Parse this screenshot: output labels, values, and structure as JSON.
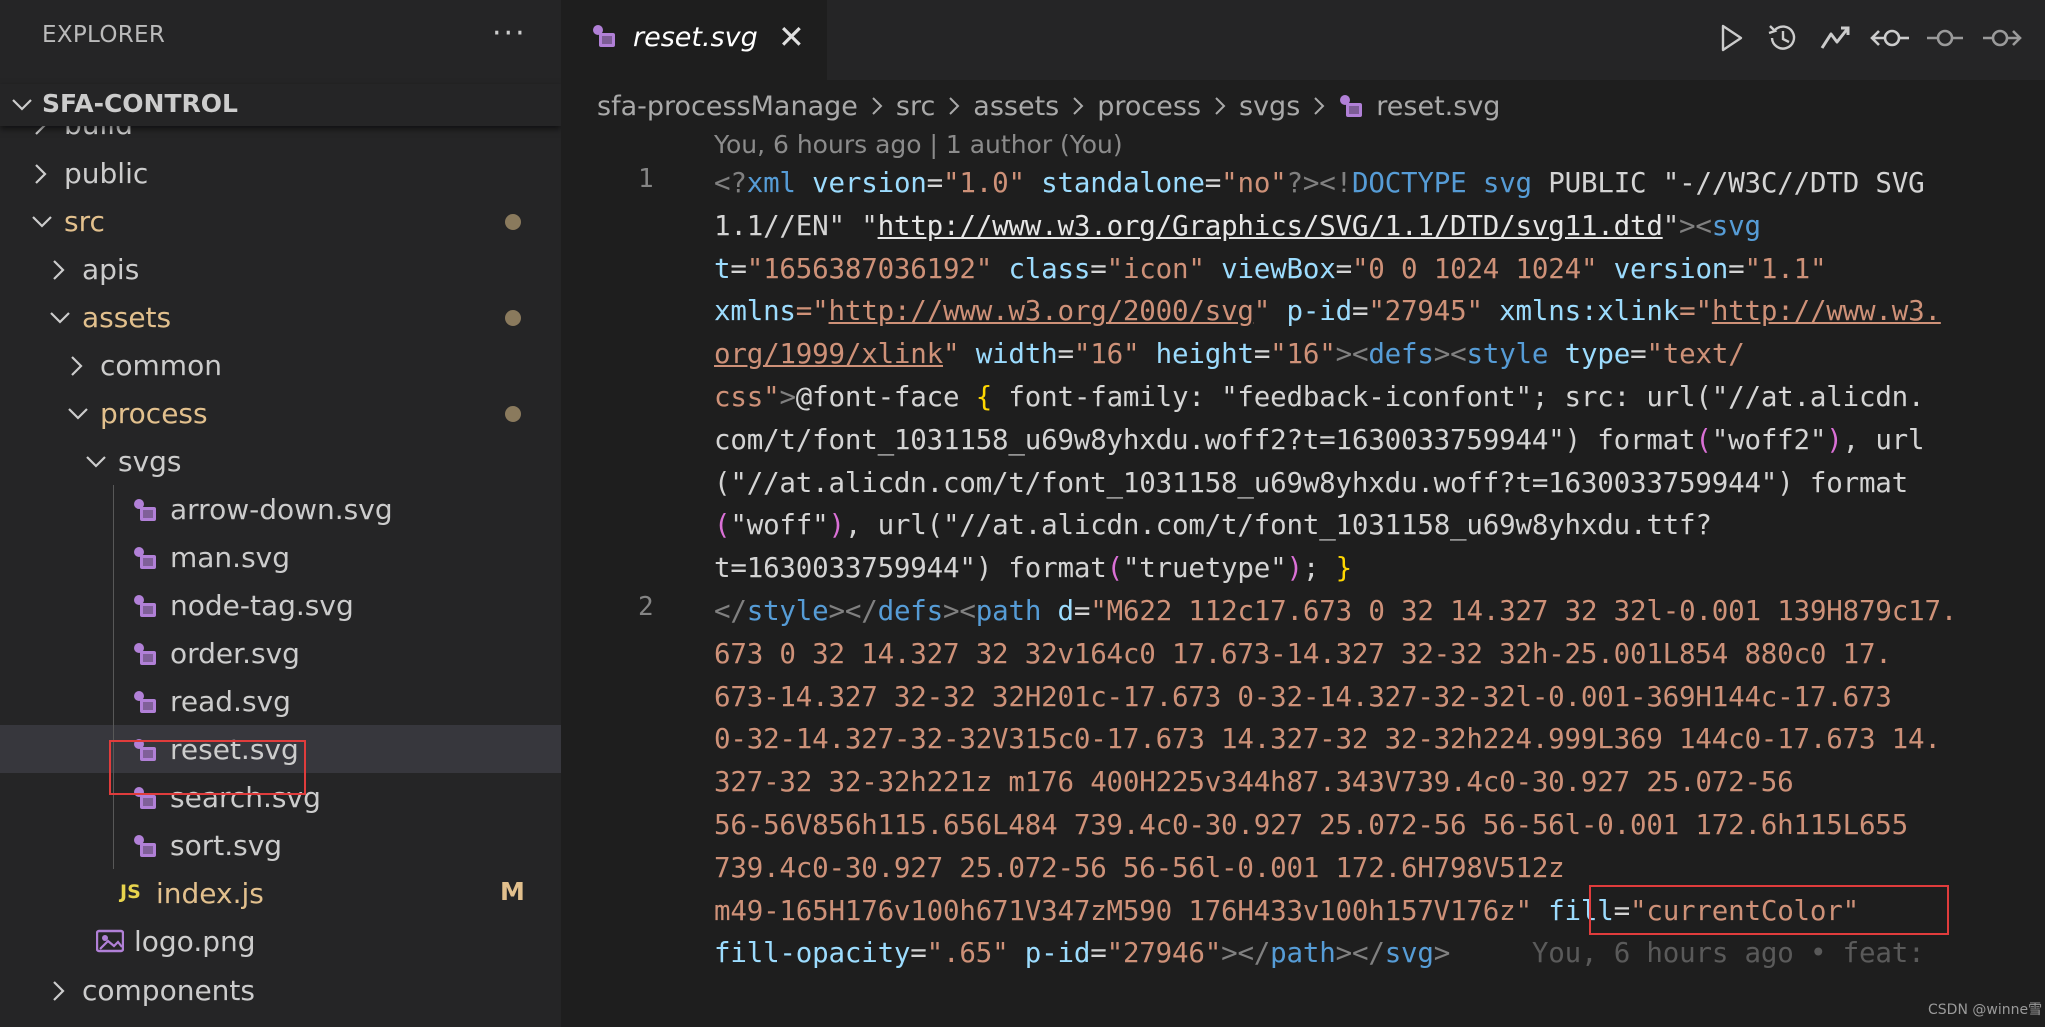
{
  "explorer": {
    "title": "EXPLORER",
    "more_label": "···",
    "project": "SFA-CONTROL",
    "tree": [
      {
        "label": "build",
        "kind": "folder",
        "expanded": false
      },
      {
        "label": "public",
        "kind": "folder",
        "expanded": false
      },
      {
        "label": "src",
        "kind": "folder",
        "expanded": true,
        "modified": true
      },
      {
        "label": "apis",
        "kind": "folder",
        "expanded": false
      },
      {
        "label": "assets",
        "kind": "folder",
        "expanded": true,
        "modified": true
      },
      {
        "label": "common",
        "kind": "folder",
        "expanded": false
      },
      {
        "label": "process",
        "kind": "folder",
        "expanded": true,
        "modified": true
      },
      {
        "label": "svgs",
        "kind": "folder",
        "expanded": true
      },
      {
        "label": "arrow-down.svg",
        "kind": "svg"
      },
      {
        "label": "man.svg",
        "kind": "svg"
      },
      {
        "label": "node-tag.svg",
        "kind": "svg"
      },
      {
        "label": "order.svg",
        "kind": "svg"
      },
      {
        "label": "read.svg",
        "kind": "svg"
      },
      {
        "label": "reset.svg",
        "kind": "svg",
        "selected": true
      },
      {
        "label": "search.svg",
        "kind": "svg"
      },
      {
        "label": "sort.svg",
        "kind": "svg"
      },
      {
        "label": "index.js",
        "kind": "js",
        "badge": "M",
        "icon_text": "JS"
      },
      {
        "label": "logo.png",
        "kind": "image"
      },
      {
        "label": "components",
        "kind": "folder",
        "expanded": false
      }
    ]
  },
  "tabs": [
    {
      "label": "reset.svg",
      "active": true,
      "icon": "svg-file-icon",
      "close": "✕"
    }
  ],
  "editor_actions": [
    "run-icon",
    "timeline-history-icon",
    "git-graph-icon",
    "go-back-commit-icon",
    "current-commit-icon",
    "go-forward-commit-icon"
  ],
  "breadcrumb": [
    "sfa-processManage",
    "src",
    "assets",
    "process",
    "svgs",
    "reset.svg"
  ],
  "blame_header": "You, 6 hours ago | 1 author (You)",
  "line_numbers": [
    "1",
    "2"
  ],
  "code_lines": [
    [
      [
        "<?",
        "p"
      ],
      [
        "xml",
        "tag"
      ],
      [
        " ",
        "plain"
      ],
      [
        "version",
        "attr"
      ],
      [
        "=",
        "plain"
      ],
      [
        "\"1.0\"",
        "str"
      ],
      [
        " ",
        "plain"
      ],
      [
        "standalone",
        "attr"
      ],
      [
        "=",
        "plain"
      ],
      [
        "\"no\"",
        "str"
      ],
      [
        "?><!",
        "p"
      ],
      [
        "DOCTYPE",
        "tag"
      ],
      [
        " ",
        "plain"
      ],
      [
        "svg",
        "tag"
      ],
      [
        " PUBLIC \"-//W3C//DTD SVG",
        "plain"
      ]
    ],
    [
      [
        "1.1//EN\" \"",
        "plain"
      ],
      [
        "http://www.w3.org/Graphics/SVG/1.1/DTD/svg11.dtd",
        "url2"
      ],
      [
        "\"",
        "plain"
      ],
      [
        "><",
        "p"
      ],
      [
        "svg",
        "tag"
      ]
    ],
    [
      [
        "t",
        "attr"
      ],
      [
        "=",
        "plain"
      ],
      [
        "\"1656387036192\"",
        "str"
      ],
      [
        " ",
        "plain"
      ],
      [
        "class",
        "attr"
      ],
      [
        "=",
        "plain"
      ],
      [
        "\"icon\"",
        "str"
      ],
      [
        " ",
        "plain"
      ],
      [
        "viewBox",
        "attr"
      ],
      [
        "=",
        "plain"
      ],
      [
        "\"0 0 1024 1024\"",
        "str"
      ],
      [
        " ",
        "plain"
      ],
      [
        "version",
        "attr"
      ],
      [
        "=",
        "plain"
      ],
      [
        "\"1.1\"",
        "str"
      ]
    ],
    [
      [
        "xmlns",
        "attr"
      ],
      [
        "=\"",
        "str"
      ],
      [
        "http://www.w3.org/2000/svg",
        "url"
      ],
      [
        "\"",
        "str"
      ],
      [
        " ",
        "plain"
      ],
      [
        "p-id",
        "attr"
      ],
      [
        "=",
        "plain"
      ],
      [
        "\"27945\"",
        "str"
      ],
      [
        " ",
        "plain"
      ],
      [
        "xmlns:xlink",
        "attr"
      ],
      [
        "=\"",
        "str"
      ],
      [
        "http://www.w3.",
        "url"
      ]
    ],
    [
      [
        "org/1999/xlink",
        "url"
      ],
      [
        "\"",
        "str"
      ],
      [
        " ",
        "plain"
      ],
      [
        "width",
        "attr"
      ],
      [
        "=",
        "plain"
      ],
      [
        "\"16\"",
        "str"
      ],
      [
        " ",
        "plain"
      ],
      [
        "height",
        "attr"
      ],
      [
        "=",
        "plain"
      ],
      [
        "\"16\"",
        "str"
      ],
      [
        "><",
        "p"
      ],
      [
        "defs",
        "tag"
      ],
      [
        "><",
        "p"
      ],
      [
        "style",
        "tag"
      ],
      [
        " ",
        "plain"
      ],
      [
        "type",
        "attr"
      ],
      [
        "=",
        "plain"
      ],
      [
        "\"text/",
        "str"
      ]
    ],
    [
      [
        "css\"",
        "str"
      ],
      [
        ">",
        "p"
      ],
      [
        "@font-face ",
        "plain"
      ],
      [
        "{",
        "brace"
      ],
      [
        " font-family: \"feedback-iconfont\"; src: url(\"//at.alicdn.",
        "plain"
      ]
    ],
    [
      [
        "com/t/font_1031158_u69w8yhxdu.woff2?t=1630033759944\") format",
        "plain"
      ],
      [
        "(",
        "bracket"
      ],
      [
        "\"woff2\"",
        "plain"
      ],
      [
        ")",
        "bracket"
      ],
      [
        ", url",
        "plain"
      ]
    ],
    [
      [
        "(\"//at.alicdn.com/t/font_1031158_u69w8yhxdu.woff?t=1630033759944\") format",
        "plain"
      ]
    ],
    [
      [
        "(",
        "bracket"
      ],
      [
        "\"woff\"",
        "plain"
      ],
      [
        ")",
        "bracket"
      ],
      [
        ", url(\"//at.alicdn.com/t/font_1031158_u69w8yhxdu.ttf?",
        "plain"
      ]
    ],
    [
      [
        "t=1630033759944\") format",
        "plain"
      ],
      [
        "(",
        "bracket"
      ],
      [
        "\"truetype\"",
        "plain"
      ],
      [
        ")",
        "bracket"
      ],
      [
        "; ",
        "plain"
      ],
      [
        "}",
        "brace"
      ]
    ],
    [
      [
        "</",
        "p"
      ],
      [
        "style",
        "tag"
      ],
      [
        "></",
        "p"
      ],
      [
        "defs",
        "tag"
      ],
      [
        "><",
        "p"
      ],
      [
        "path",
        "tag"
      ],
      [
        " ",
        "plain"
      ],
      [
        "d",
        "attr"
      ],
      [
        "=",
        "plain"
      ],
      [
        "\"M622 112c17.673 0 32 14.327 32 32l-0.001 139H879c17.",
        "str"
      ]
    ],
    [
      [
        "673 0 32 14.327 32 32v164c0 17.673-14.327 32-32 32h-25.001L854 880c0 17.",
        "str"
      ]
    ],
    [
      [
        "673-14.327 32-32 32H201c-17.673 0-32-14.327-32-32l-0.001-369H144c-17.673",
        "str"
      ]
    ],
    [
      [
        "0-32-14.327-32-32V315c0-17.673 14.327-32 32-32h224.999L369 144c0-17.673 14.",
        "str"
      ]
    ],
    [
      [
        "327-32 32-32h221z m176 400H225v344h87.343V739.4c0-30.927 25.072-56",
        "str"
      ]
    ],
    [
      [
        "56-56V856h115.656L484 739.4c0-30.927 25.072-56 56-56l-0.001 172.6h115L655",
        "str"
      ]
    ],
    [
      [
        "739.4c0-30.927 25.072-56 56-56l-0.001 172.6H798V512z",
        "str"
      ]
    ],
    [
      [
        "m49-165H176v100h671V347zM590 176H433v100h157V176z\"",
        "str"
      ],
      [
        " ",
        "plain"
      ],
      [
        "fill",
        "attr"
      ],
      [
        "=",
        "plain"
      ],
      [
        "\"currentColor\"",
        "str"
      ]
    ],
    [
      [
        "fill-opacity",
        "attr"
      ],
      [
        "=",
        "plain"
      ],
      [
        "\".65\"",
        "str"
      ],
      [
        " ",
        "plain"
      ],
      [
        "p-id",
        "attr"
      ],
      [
        "=",
        "plain"
      ],
      [
        "\"27946\"",
        "str"
      ],
      [
        "></",
        "p"
      ],
      [
        "path",
        "tag"
      ],
      [
        "></",
        "p"
      ],
      [
        "svg",
        "tag"
      ],
      [
        ">",
        "p"
      ],
      [
        "     You, 6 hours ago • feat: ",
        "blame"
      ]
    ]
  ],
  "watermark": "CSDN @winne雪",
  "colors": {
    "sidebar_bg": "#252526",
    "editor_bg": "#1e1e1e",
    "selection_bg": "#37373d",
    "modified": "#e2c08d",
    "highlight_box": "#e03c3c",
    "svg_icon": "#b180d7"
  }
}
